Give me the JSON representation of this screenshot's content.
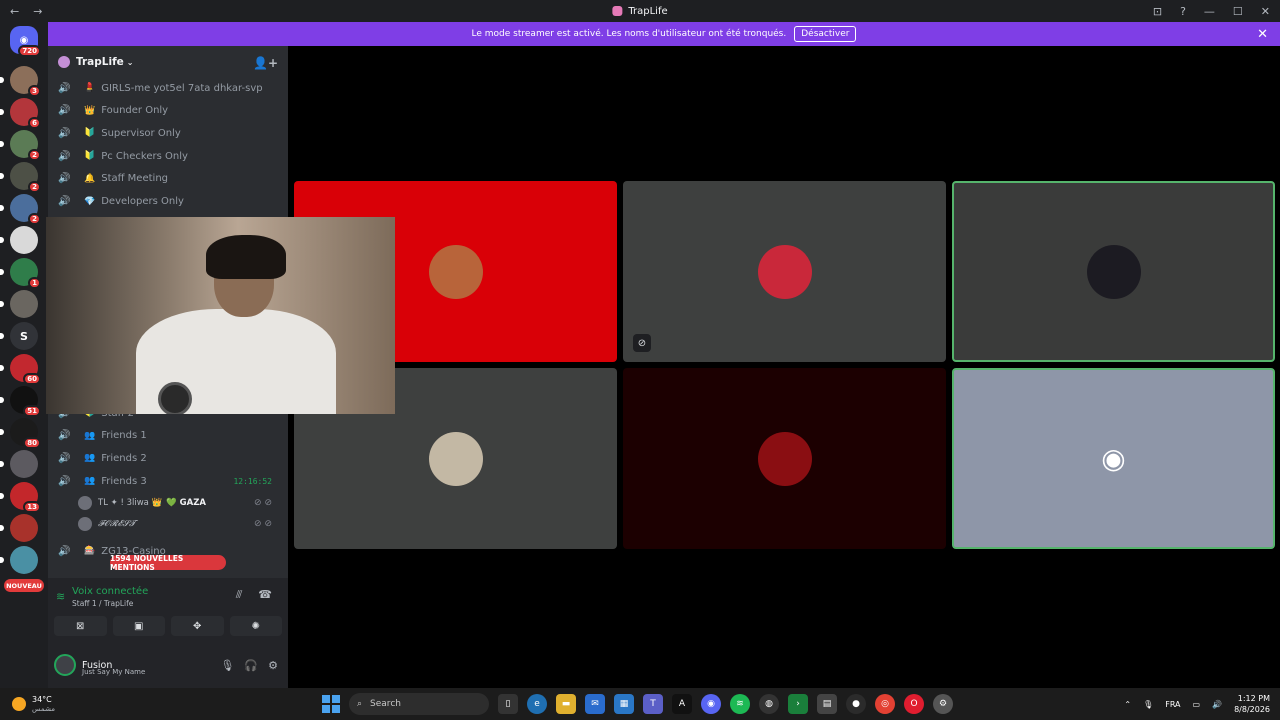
{
  "window": {
    "title": "TrapLife",
    "back": "←",
    "forward": "→",
    "controls": [
      "⊡",
      "?",
      "—",
      "☐",
      "✕"
    ]
  },
  "banner": {
    "text": "Le mode streamer est activé. Les noms d'utilisateur ont été tronqués.",
    "button": "Désactiver",
    "close": "✕"
  },
  "rail": {
    "home_badge": "720",
    "servers": [
      {
        "badge": "3",
        "color": "#8c6f5a"
      },
      {
        "badge": "6",
        "color": "#b3363b"
      },
      {
        "badge": "2",
        "color": "#5b7b55"
      },
      {
        "badge": "2",
        "color": "#4d5046"
      },
      {
        "badge": "2",
        "color": "#4b6e9c"
      },
      {
        "badge": "",
        "color": "#d9d9d9"
      },
      {
        "badge": "1",
        "color": "#2f7d4a"
      },
      {
        "badge": "",
        "color": "#6a6660"
      },
      {
        "badge": "",
        "label": "S",
        "color": "#313338"
      },
      {
        "badge": "60",
        "color": "#c2282f"
      },
      {
        "badge": "51",
        "color": "#111111"
      },
      {
        "badge": "80",
        "color": "#1b1b1b"
      },
      {
        "badge": "",
        "color": "#5c5a60"
      },
      {
        "badge": "13",
        "color": "#c3272b"
      },
      {
        "badge": "",
        "color": "#a8322b"
      },
      {
        "badge": "",
        "color": "#4a90a4"
      }
    ],
    "nouveau": "NOUVEAU"
  },
  "sidebar": {
    "guild_name": "TrapLife",
    "channels_top": [
      {
        "name": "GIRLS-me yot5el 7ata dhkar-svp",
        "emoji": "💄"
      },
      {
        "name": "Founder Only",
        "emoji": "👑"
      },
      {
        "name": "Supervisor Only",
        "emoji": "🔰"
      },
      {
        "name": "Pc Checkers Only",
        "emoji": "🔰"
      },
      {
        "name": "Staff Meeting",
        "emoji": "🔔"
      },
      {
        "name": "Developers Only",
        "emoji": "💎"
      }
    ],
    "channels_bottom": [
      {
        "name": "Staff 2",
        "emoji": "🔰"
      },
      {
        "name": "Friends 1",
        "emoji": "👥"
      },
      {
        "name": "Friends 2",
        "emoji": "👥"
      },
      {
        "name": "Friends 3",
        "emoji": "👥",
        "time": "12:16:52"
      },
      {
        "name": "ZG13-Casino",
        "emoji": "🎰"
      }
    ],
    "members": [
      {
        "name": "TL ✦ ! 3liwa 👑 ",
        "tag": "💚 GAZA"
      },
      {
        "name": "𝓕𝓞𝓡𝓔𝓢𝓣",
        "tag": ""
      }
    ],
    "mentions_pill": "1594 NOUVELLES MENTIONS",
    "voice": {
      "status": "Voix connectée",
      "channel": "Staff 1 / TrapLife"
    },
    "user": {
      "name": "Fusion",
      "status": "Just Say My Name"
    }
  },
  "grid": {
    "tiles": [
      {
        "bg": "#d90007",
        "avatar": "#b8643a",
        "border": "none"
      },
      {
        "bg": "#3e403f",
        "avatar": "#c9283a",
        "border": "none"
      },
      {
        "bg": "#3a3b3a",
        "avatar": "#1c1b22",
        "border": "#56b46c"
      },
      {
        "bg": "#3e403f",
        "avatar": "#c3b8a4",
        "border": "none"
      },
      {
        "bg": "#1c0001",
        "avatar": "#8a0e12",
        "border": "none"
      },
      {
        "bg": "#8e96a8",
        "avatar": "",
        "border": "#56b46c"
      }
    ]
  },
  "taskbar": {
    "temp": "34°C",
    "condition": "مشمس",
    "search_placeholder": "Search",
    "lang": "FRA",
    "time": "1:12 PM",
    "date": "8/8/2026"
  },
  "colors": {
    "accent": "#7f3ee6",
    "online": "#23a55a",
    "danger": "#da373c"
  }
}
